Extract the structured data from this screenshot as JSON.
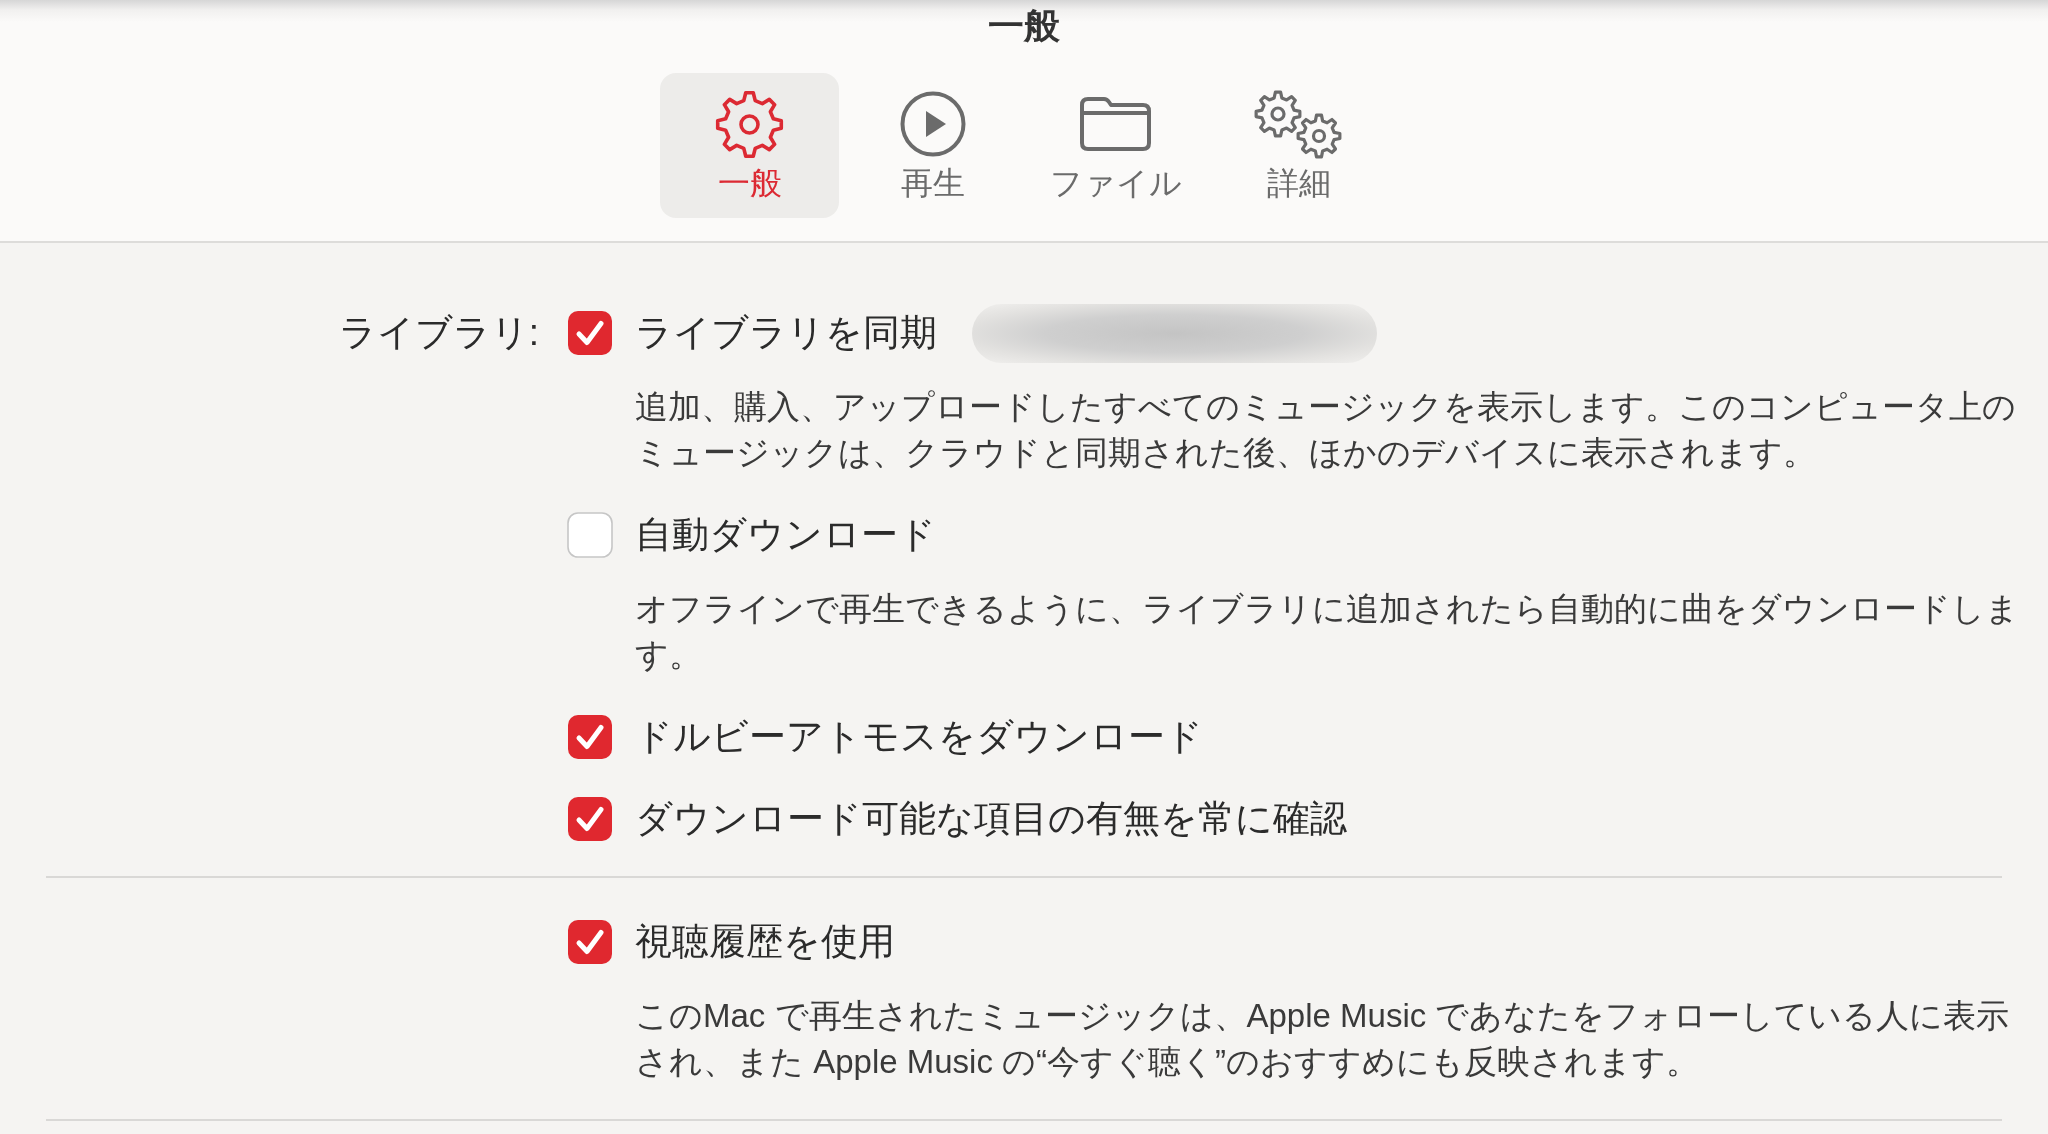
{
  "window": {
    "title": "一般"
  },
  "tabs": [
    {
      "label": "一般",
      "selected": true
    },
    {
      "label": "再生",
      "selected": false
    },
    {
      "label": "ファイル",
      "selected": false
    },
    {
      "label": "詳細",
      "selected": false
    }
  ],
  "sections": [
    {
      "label": "ライブラリ:",
      "options": [
        {
          "label": "ライブラリを同期",
          "checked": true,
          "redacted": true,
          "description": "追加、購入、アップロードしたすべてのミュージックを表示します。このコンピュータ上のミュージックは、クラウドと同期された後、ほかのデバイスに表示されます。"
        },
        {
          "label": "自動ダウンロード",
          "checked": false,
          "description": "オフラインで再生できるように、ライブラリに追加されたら自動的に曲をダウンロードします。"
        },
        {
          "label": "ドルビーアトモスをダウンロード",
          "checked": true
        },
        {
          "label": "ダウンロード可能な項目の有無を常に確認",
          "checked": true
        }
      ]
    },
    {
      "options": [
        {
          "label": "視聴履歴を使用",
          "checked": true,
          "description": "このMac で再生されたミュージックは、Apple Music であなたをフォローしている人に表示され、また Apple Music の“今すぐ聴く”のおすすめにも反映されます。"
        }
      ]
    }
  ]
}
